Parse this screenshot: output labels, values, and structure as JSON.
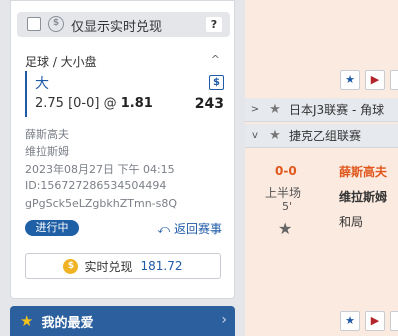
{
  "realtime_filter": {
    "label": "仅显示实时兑现",
    "help": "?"
  },
  "bet": {
    "title": "足球 / 大小盘",
    "collapse_icon": "^",
    "selection": "大",
    "cashout_icon": "$",
    "handicap": "2.75 [0-0] @",
    "odds": "1.81",
    "stake": "243",
    "home": "薛斯高夫",
    "away": "维拉斯姆",
    "datetime": "2023年08月27日 下午 04:15",
    "id": "ID:15672728653450449​4",
    "ref": "gPgSck5eLZgbkhZTmn-s8Q",
    "status": "进行中",
    "back_link": "返回赛事",
    "cashout_label": "实时兑现",
    "cashout_amount": "181.72"
  },
  "favorites": {
    "label": "我的最爱"
  },
  "events": {
    "leagues": [
      "日本J3联赛 - 角球",
      "捷克乙组联赛"
    ],
    "match": {
      "score": "0-0",
      "period": "上半场",
      "minute": "5'",
      "home": "薛斯高夫",
      "away": "维拉斯姆",
      "draw": "和局"
    }
  }
}
